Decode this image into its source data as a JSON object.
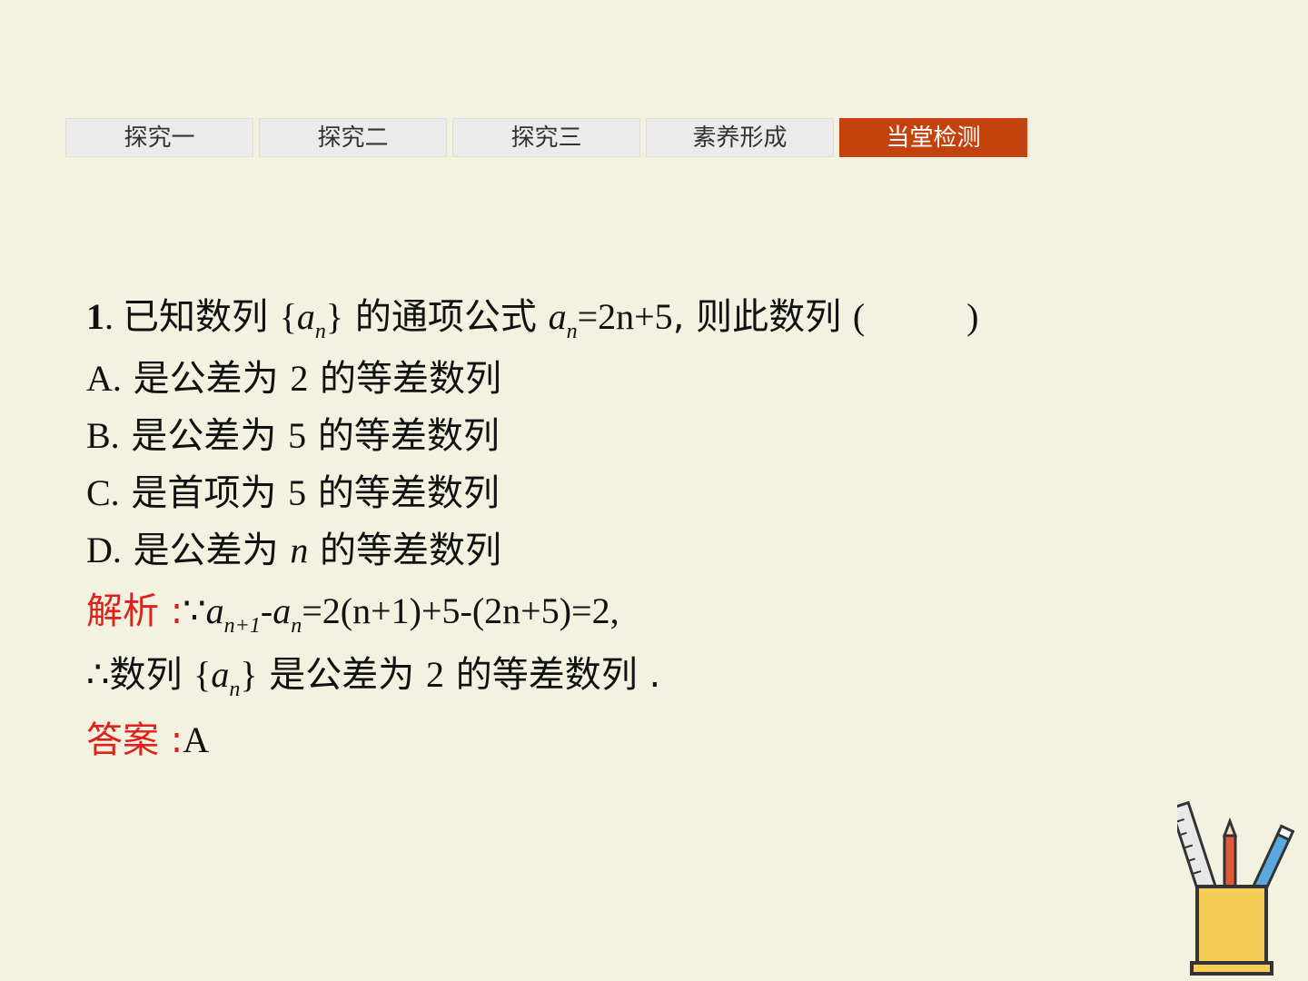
{
  "tabs": [
    {
      "label": "探究一",
      "active": false
    },
    {
      "label": "探究二",
      "active": false
    },
    {
      "label": "探究三",
      "active": false
    },
    {
      "label": "素养形成",
      "active": false
    },
    {
      "label": "当堂检测",
      "active": true
    }
  ],
  "colors": {
    "background": "#f3f1e0",
    "active_tab": "#c4420e",
    "tab": "#ebebeb",
    "highlight": "#e0201a"
  },
  "question": {
    "number": "1",
    "stem_a": "已知数列",
    "stem_b": "的通项公式",
    "stem_c": ", 则此数列",
    "paren_open": "(",
    "paren_close": ")",
    "seq": "a",
    "sub": "n",
    "formula_rhs": "=2n+5"
  },
  "options": [
    {
      "letter": "A.",
      "text_a": "是公差为",
      "value": "2",
      "text_b": "的等差数列"
    },
    {
      "letter": "B.",
      "text_a": "是公差为",
      "value": "5",
      "text_b": "的等差数列"
    },
    {
      "letter": "C.",
      "text_a": "是首项为",
      "value": "5",
      "text_b": "的等差数列"
    },
    {
      "letter": "D.",
      "text_a": "是公差为",
      "value": "n",
      "text_b": "的等差数列"
    }
  ],
  "analysis": {
    "label": "解析",
    "colon": ":",
    "because": "∵",
    "sub1": "n+1",
    "minus": "-",
    "sub2": "n",
    "rhs": "=2(n+1)+5-(2n+5)=2,",
    "therefore": "∴",
    "conc_a": "数列",
    "conc_b": "是公差为",
    "conc_value": "2",
    "conc_c": "的等差数列 ."
  },
  "answer": {
    "label": "答案",
    "colon": ":",
    "value": "A"
  },
  "decoration": {
    "icon": "pencil-holder-icon"
  }
}
